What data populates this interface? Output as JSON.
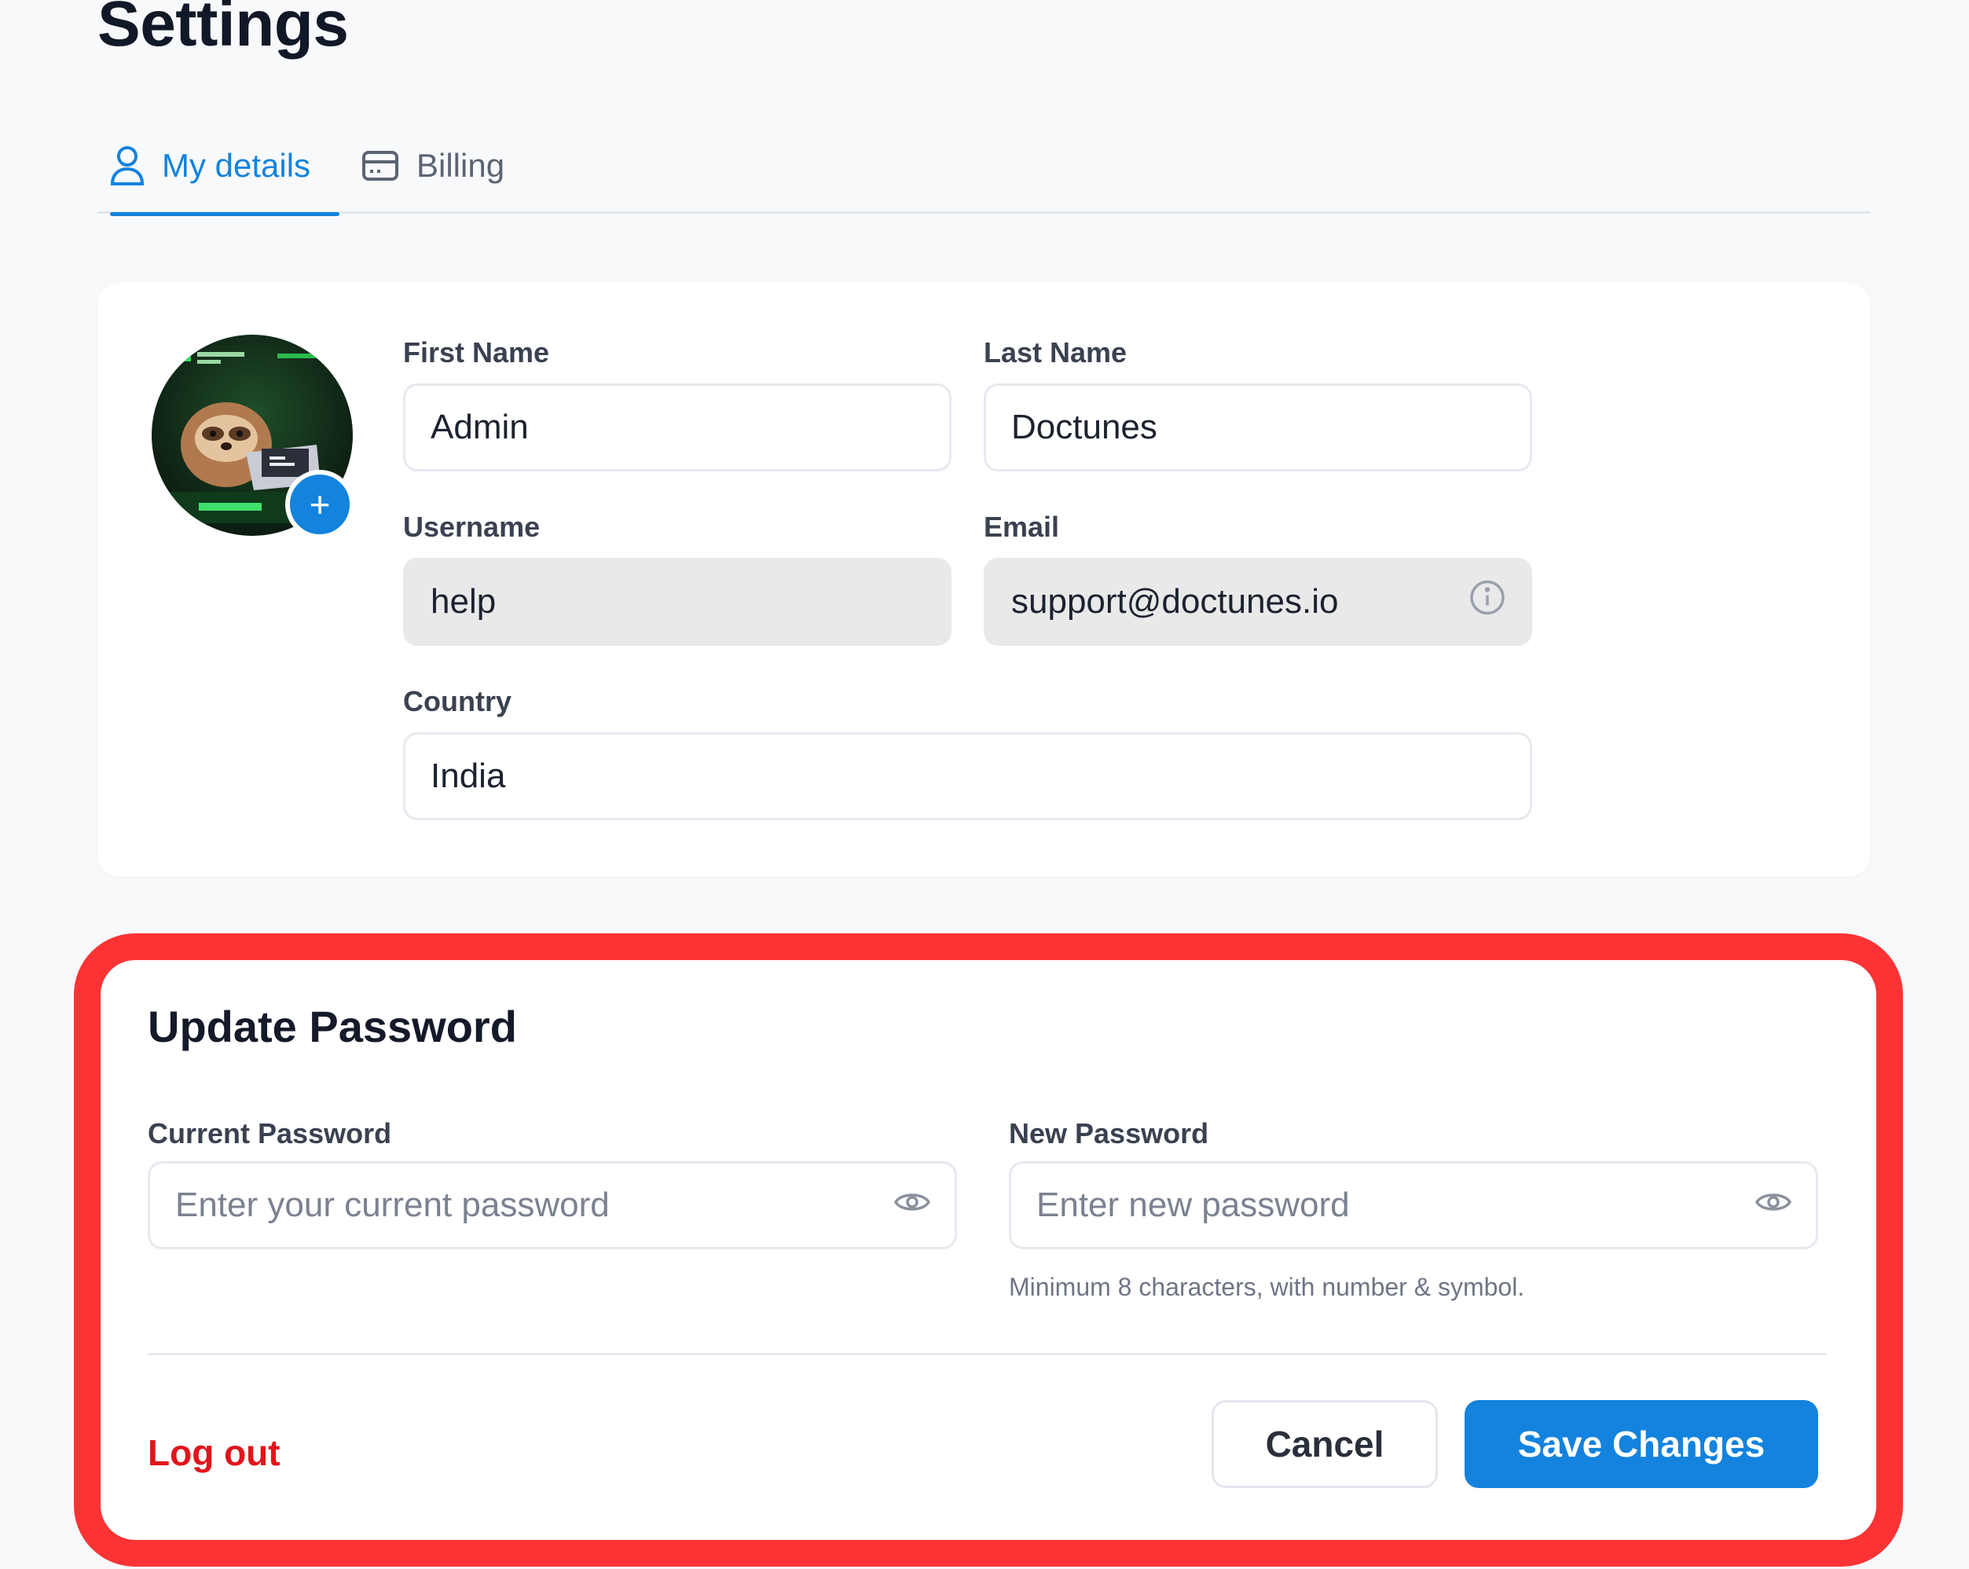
{
  "page": {
    "title": "Settings"
  },
  "tabs": [
    {
      "label": "My details",
      "icon": "user-icon",
      "active": true
    },
    {
      "label": "Billing",
      "icon": "credit-card-icon",
      "active": false
    }
  ],
  "colors": {
    "accent": "#1383dd",
    "danger": "#e3141b",
    "highlight_border": "#fb3334"
  },
  "profile": {
    "first_name": {
      "label": "First Name",
      "value": "Admin"
    },
    "last_name": {
      "label": "Last Name",
      "value": "Doctunes"
    },
    "username": {
      "label": "Username",
      "value": "help"
    },
    "email": {
      "label": "Email",
      "value": "support@doctunes.io"
    },
    "country": {
      "label": "Country",
      "value": "India"
    },
    "avatar_add": "+"
  },
  "password": {
    "title": "Update Password",
    "current": {
      "label": "Current Password",
      "placeholder": "Enter your current password"
    },
    "new": {
      "label": "New Password",
      "placeholder": "Enter new password",
      "hint": "Minimum 8 characters, with number & symbol."
    },
    "logout_label": "Log out",
    "cancel_label": "Cancel",
    "save_label": "Save Changes"
  }
}
